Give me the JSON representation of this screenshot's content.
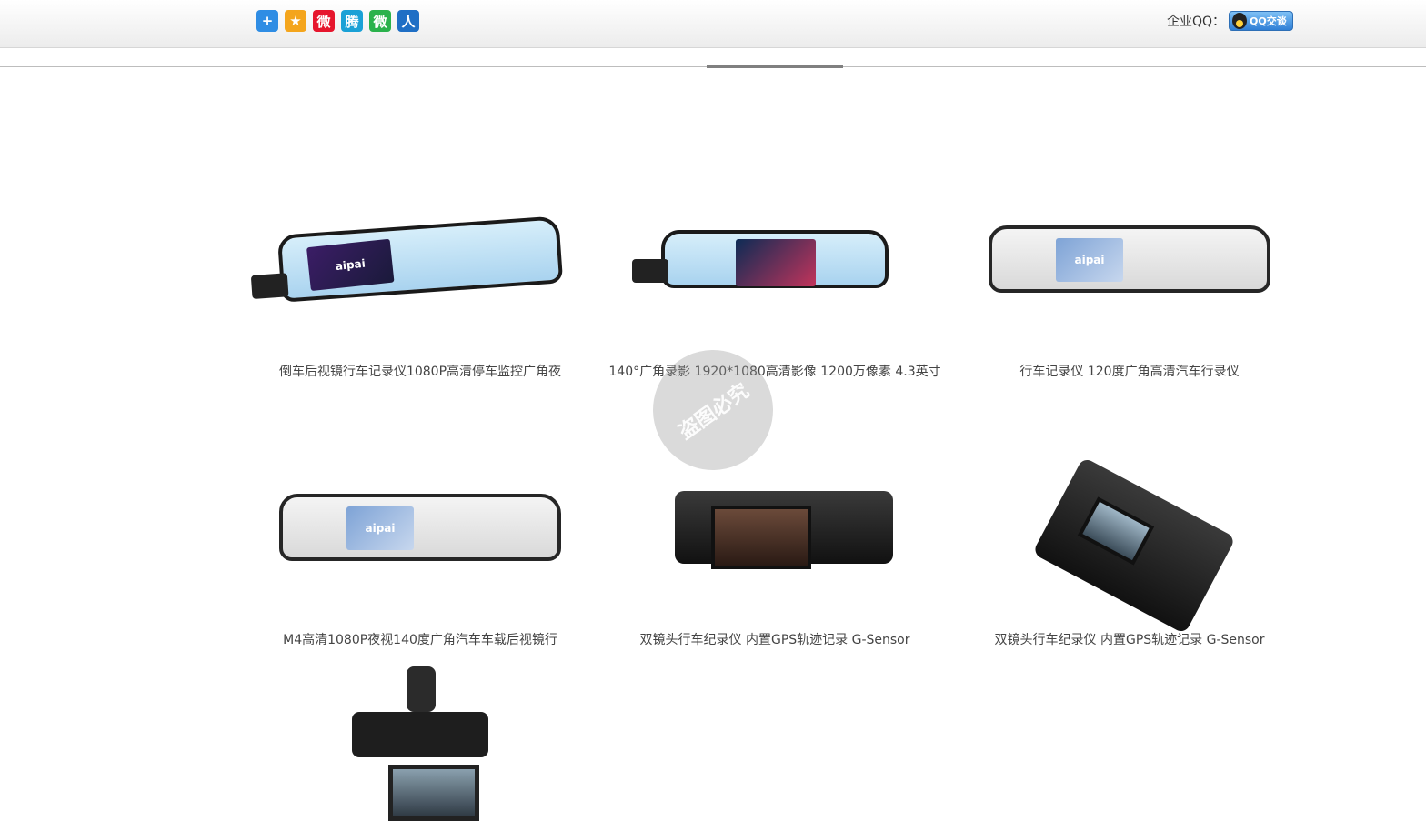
{
  "header": {
    "share_icons": [
      {
        "name": "share-plus-icon",
        "glyph": "+",
        "color": "#2f8de4"
      },
      {
        "name": "qzone-star-icon",
        "glyph": "★",
        "color": "#f4a51c"
      },
      {
        "name": "weibo-icon",
        "glyph": "微",
        "color": "#e6162d"
      },
      {
        "name": "tencent-weibo-icon",
        "glyph": "腾",
        "color": "#1aa1d6"
      },
      {
        "name": "wechat-icon",
        "glyph": "微",
        "color": "#2bb24c"
      },
      {
        "name": "renren-icon",
        "glyph": "人",
        "color": "#1f6fc5"
      }
    ],
    "qq_label": "企业QQ：",
    "qq_button": "QQ交谈"
  },
  "products": [
    {
      "caption": "倒车后视镜行车记录仪1080P高清停车监控广角夜",
      "image": "mirror-dvr-blue"
    },
    {
      "caption": "140°广角录影 1920*1080高清影像 1200万像素 4.3英寸",
      "image": "mirror-dvr-dashboard"
    },
    {
      "caption": "行车记录仪 120度广角高清汽车行录仪",
      "image": "mirror-dvr-grey"
    },
    {
      "caption": "M4高清1080P夜视140度广角汽车车载后视镜行",
      "image": "mirror-dvr-grey"
    },
    {
      "caption": "双镜头行车纪录仪 内置GPS轨迹记录 G-Sensor",
      "image": "dual-lens-dashcam"
    },
    {
      "caption": "双镜头行车纪录仪 内置GPS轨迹记录 G-Sensor",
      "image": "dual-lens-dashcam-tilted"
    },
    {
      "caption": "",
      "image": "rotating-lens-dashcam"
    }
  ],
  "screen_brand": "aipai"
}
